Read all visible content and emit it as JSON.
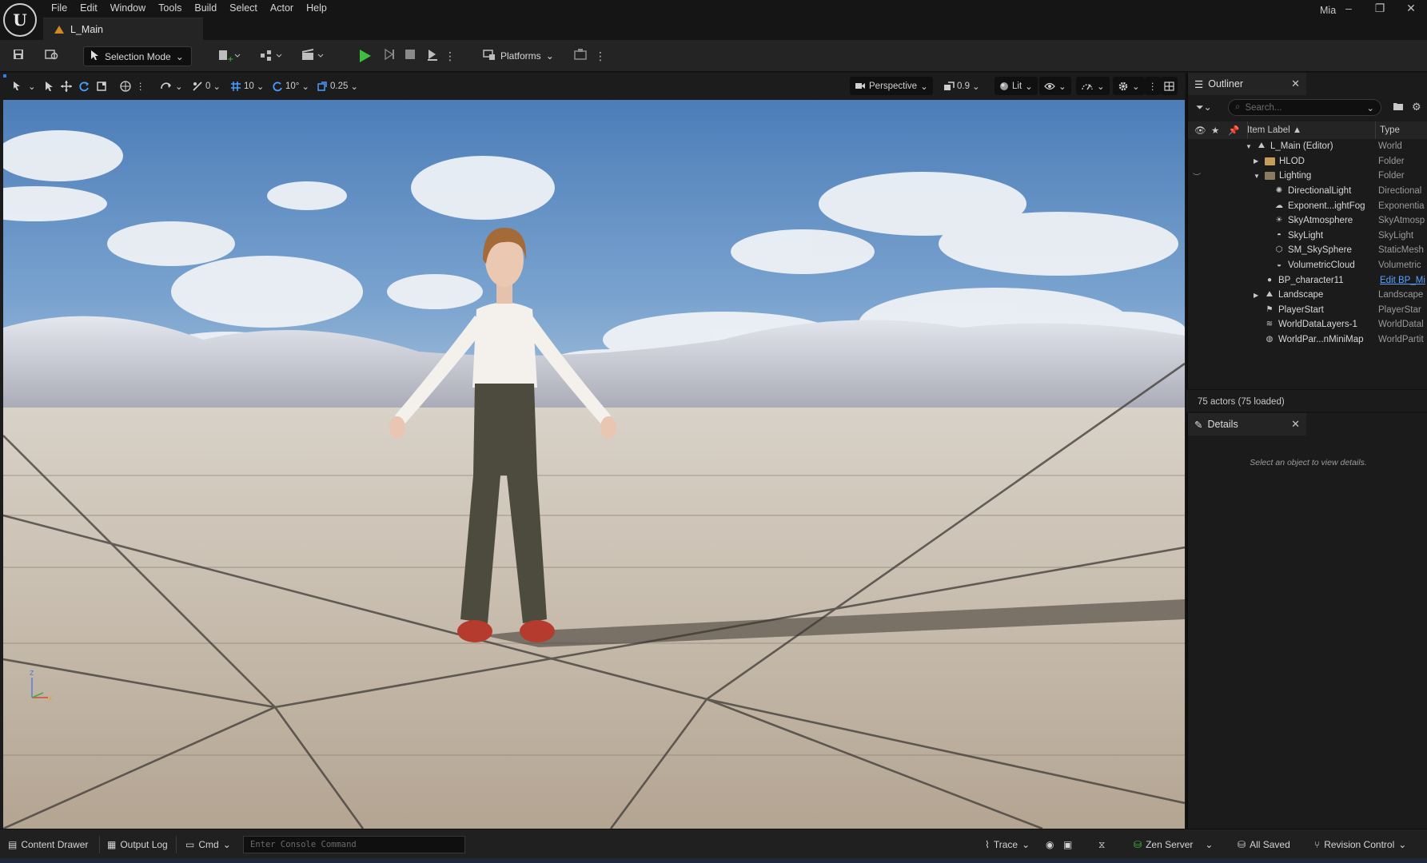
{
  "app": {
    "logo_text": "U",
    "document_tab": "L_Main",
    "user": "Mia"
  },
  "menu": [
    "File",
    "Edit",
    "Window",
    "Tools",
    "Build",
    "Select",
    "Actor",
    "Help"
  ],
  "window_controls": {
    "minimize": "–",
    "restore": "❐",
    "close": "✕"
  },
  "toolbar": {
    "selection_mode": "Selection Mode",
    "platforms": "Platforms"
  },
  "viewport_toolbar": {
    "rotate_snap": "0",
    "grid_snap": "10",
    "rotation_snap": "10°",
    "scale_snap": "0.25",
    "view_mode": "Perspective",
    "camera_speed": "0.9",
    "lighting": "Lit",
    "axis_z": "z",
    "axis_x": "x"
  },
  "outliner": {
    "title": "Outliner",
    "search_placeholder": "Search...",
    "col_label": "Item Label ▲",
    "col_type": "Type",
    "rows": [
      {
        "label": "L_Main (Editor)",
        "type": "World",
        "icon": "world-icon"
      },
      {
        "label": "HLOD",
        "type": "Folder",
        "icon": "folder-icon"
      },
      {
        "label": "Lighting",
        "type": "Folder",
        "icon": "folder-icon"
      },
      {
        "label": "DirectionalLight",
        "type": "Directional",
        "icon": "sun-icon"
      },
      {
        "label": "Exponent...ightFog",
        "type": "Exponentia",
        "icon": "fog-icon"
      },
      {
        "label": "SkyAtmosphere",
        "type": "SkyAtmosp",
        "icon": "atmosphere-icon"
      },
      {
        "label": "SkyLight",
        "type": "SkyLight",
        "icon": "skylight-icon"
      },
      {
        "label": "SM_SkySphere",
        "type": "StaticMesh",
        "icon": "mesh-icon"
      },
      {
        "label": "VolumetricCloud",
        "type": "Volumetric",
        "icon": "cloud-icon"
      },
      {
        "label": "BP_character11",
        "type": "Edit BP_Mi",
        "icon": "pawn-icon"
      },
      {
        "label": "Landscape",
        "type": "Landscape",
        "icon": "landscape-icon"
      },
      {
        "label": "PlayerStart",
        "type": "PlayerStar",
        "icon": "flag-icon"
      },
      {
        "label": "WorldDataLayers-1",
        "type": "WorldDatal",
        "icon": "layers-icon"
      },
      {
        "label": "WorldPar...nMiniMap",
        "type": "WorldPartit",
        "icon": "minimap-icon"
      }
    ],
    "status": "75 actors (75 loaded)"
  },
  "details": {
    "title": "Details",
    "empty_message": "Select an object to view details."
  },
  "bottom_bar": {
    "content_drawer": "Content Drawer",
    "output_log": "Output Log",
    "cmd": "Cmd",
    "console_placeholder": "Enter Console Command",
    "trace": "Trace",
    "zen_server": "Zen Server",
    "all_saved": "All Saved",
    "revision_control": "Revision Control"
  },
  "colors": {
    "play_green": "#3fbf3f",
    "link_blue": "#5aa0ff",
    "accent_orange": "#d08a1f"
  }
}
